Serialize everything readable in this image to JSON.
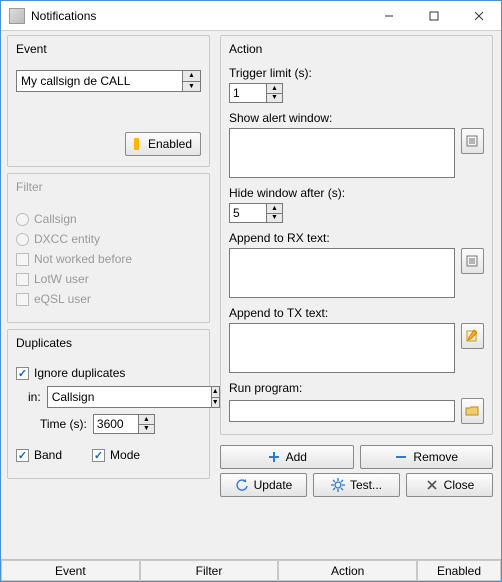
{
  "window": {
    "title": "Notifications"
  },
  "event": {
    "group_label": "Event",
    "selected": "My callsign de CALL",
    "enabled_btn": "Enabled"
  },
  "filter": {
    "group_label": "Filter",
    "callsign": "Callsign",
    "dxcc": "DXCC entity",
    "nwb": "Not worked before",
    "lotw": "LotW user",
    "eqsl": "eQSL user"
  },
  "duplicates": {
    "group_label": "Duplicates",
    "ignore_label": "Ignore duplicates",
    "in_label": "in:",
    "in_value": "Callsign",
    "time_label": "Time (s):",
    "time_value": "3600",
    "band_label": "Band",
    "mode_label": "Mode"
  },
  "action": {
    "group_label": "Action",
    "trigger_label": "Trigger limit (s):",
    "trigger_value": "1",
    "show_alert_label": "Show alert window:",
    "hide_after_label": "Hide window after (s):",
    "hide_after_value": "5",
    "append_rx_label": "Append to RX text:",
    "append_tx_label": "Append to TX text:",
    "run_program_label": "Run program:"
  },
  "buttons": {
    "add": "Add",
    "remove": "Remove",
    "update": "Update",
    "test": "Test...",
    "close": "Close"
  },
  "status": {
    "event": "Event",
    "filter": "Filter",
    "action": "Action",
    "enabled": "Enabled"
  }
}
